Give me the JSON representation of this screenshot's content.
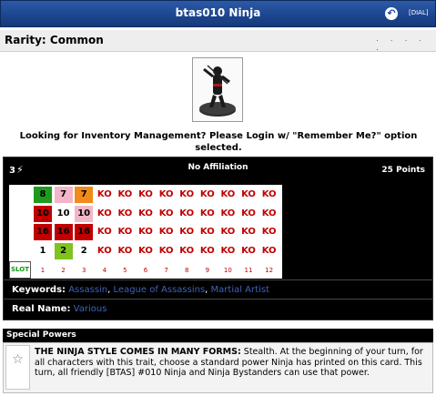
{
  "header": {
    "title": "btas010 Ninja",
    "back_icon": "back-arrow-icon",
    "dial_link": "[DIAL]"
  },
  "rarity": {
    "label": "Rarity: Common",
    "dots": ". . . . ."
  },
  "inventory_notice": "Looking for Inventory Management? Please Login w/ \"Remember Me?\" option selected.",
  "dial": {
    "range": "3",
    "affiliation": "No Affiliation",
    "points": "25 Points",
    "stat_icons": [
      "speed-icon",
      "attack-icon",
      "defense-icon",
      "damage-icon"
    ],
    "rows": [
      [
        "8",
        "7",
        "7",
        "KO",
        "KO",
        "KO",
        "KO",
        "KO",
        "KO",
        "KO",
        "KO",
        "KO"
      ],
      [
        "10",
        "10",
        "10",
        "KO",
        "KO",
        "KO",
        "KO",
        "KO",
        "KO",
        "KO",
        "KO",
        "KO"
      ],
      [
        "16",
        "16",
        "16",
        "KO",
        "KO",
        "KO",
        "KO",
        "KO",
        "KO",
        "KO",
        "KO",
        "KO"
      ],
      [
        "1",
        "2",
        "2",
        "KO",
        "KO",
        "KO",
        "KO",
        "KO",
        "KO",
        "KO",
        "KO",
        "KO"
      ]
    ],
    "cell_colors": [
      [
        "#1f9a1f",
        "#f3b6c8",
        "#f08a1a"
      ],
      [
        "#c00000",
        "#ffffff",
        "#f3b6c8"
      ],
      [
        "#c00000",
        "#c00000",
        "#c00000"
      ],
      [
        "#ffffff",
        "#7fc31f",
        "#ffffff"
      ]
    ],
    "slot_label": "SLOT",
    "clicks": [
      "1",
      "2",
      "3",
      "4",
      "5",
      "6",
      "7",
      "8",
      "9",
      "10",
      "11",
      "12"
    ],
    "keywords_label": "Keywords:",
    "keywords": [
      "Assassin",
      "League of Assassins",
      "Martial Artist"
    ],
    "real_name_label": "Real Name:",
    "real_name": "Various"
  },
  "special_powers": {
    "title": "Special Powers",
    "icon": "star-outline-icon",
    "power_name": "THE NINJA STYLE COMES IN MANY FORMS:",
    "power_text": "Stealth. At the beginning of your turn, for all characters with this trait, choose a standard power Ninja has printed on this card. This turn, all friendly [BTAS] #010 Ninja and Ninja Bystanders can use that power."
  }
}
